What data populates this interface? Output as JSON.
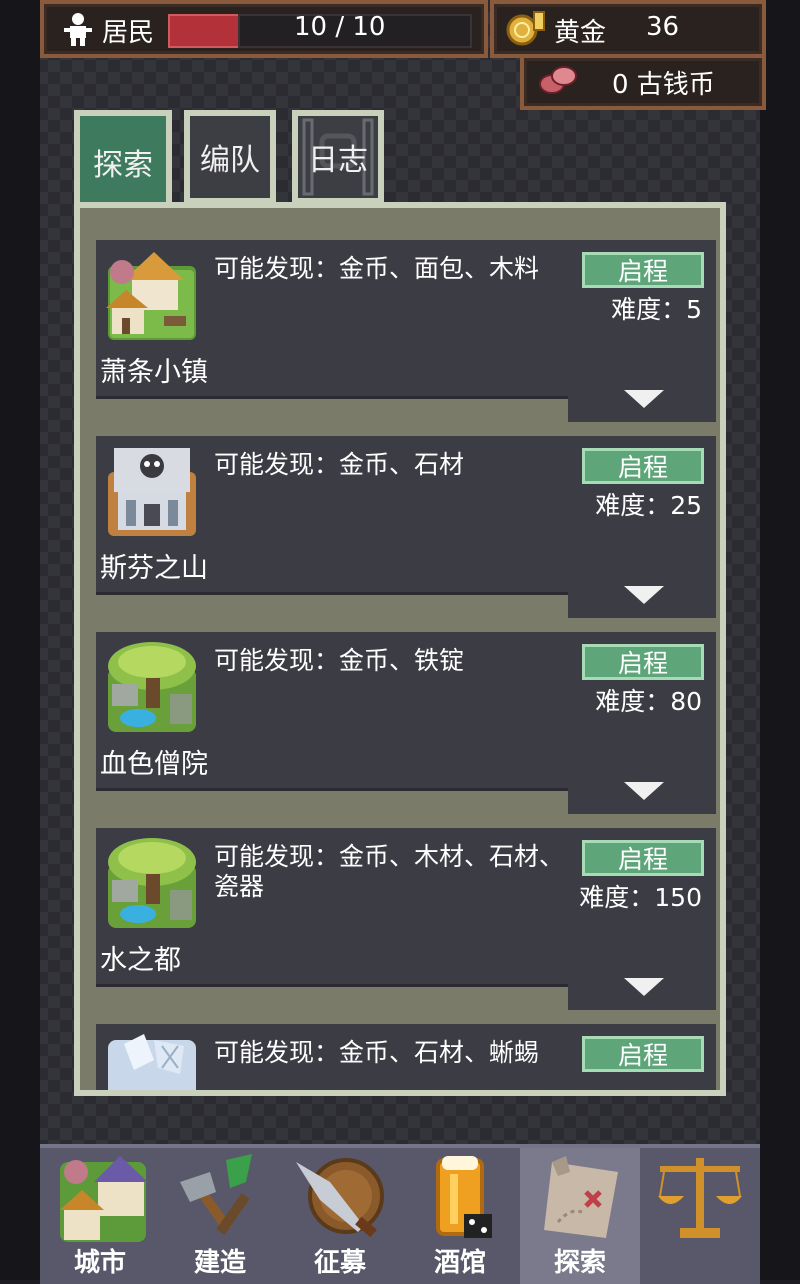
{
  "topbar": {
    "resident_label": "居民",
    "resident_count": "10 / 10",
    "gold_label": "黄金",
    "gold_value": "36",
    "coin_value": "0 古钱币",
    "colors": {
      "frame": "#8a5a3c",
      "hp": "#b3323a"
    }
  },
  "tabs": [
    {
      "label": "探索",
      "active": true
    },
    {
      "label": "编队",
      "active": false
    },
    {
      "label": "日志",
      "active": false
    }
  ],
  "expeditions": [
    {
      "name": "萧条小镇",
      "find": "可能发现：金币、面包、木料",
      "button": "启程",
      "difficulty": "难度：5",
      "icon": "town-icon"
    },
    {
      "name": "斯芬之山",
      "find": "可能发现：金币、石材",
      "button": "启程",
      "difficulty": "难度：25",
      "icon": "temple-icon"
    },
    {
      "name": "血色僧院",
      "find": "可能发现：金币、铁锭",
      "button": "启程",
      "difficulty": "难度：80",
      "icon": "forest-icon"
    },
    {
      "name": "水之都",
      "find": "可能发现：金币、木材、石材、瓷器",
      "button": "启程",
      "difficulty": "难度：150",
      "icon": "forest-icon"
    },
    {
      "name": "",
      "find": "可能发现：金币、石材、蜥蜴",
      "button": "启程",
      "difficulty": "",
      "icon": "ice-icon"
    }
  ],
  "nav": [
    {
      "label": "城市",
      "icon": "city-icon"
    },
    {
      "label": "建造",
      "icon": "build-tools-icon"
    },
    {
      "label": "征募",
      "icon": "recruit-weapons-icon"
    },
    {
      "label": "酒馆",
      "icon": "tavern-beer-icon"
    },
    {
      "label": "探索",
      "icon": "treasure-map-icon",
      "selected": true
    },
    {
      "label": "",
      "icon": "scales-icon"
    }
  ],
  "accent": {
    "go_button": "#5ea67a",
    "active_tab": "#3d7a5e"
  }
}
